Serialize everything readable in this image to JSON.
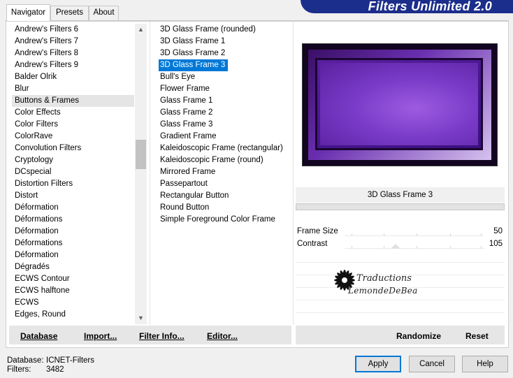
{
  "tabs": [
    {
      "label": "Navigator",
      "active": true
    },
    {
      "label": "Presets",
      "active": false
    },
    {
      "label": "About",
      "active": false
    }
  ],
  "banner_title": "Filters Unlimited 2.0",
  "categories": {
    "items": [
      "Andrew's Filters 6",
      "Andrew's Filters 7",
      "Andrew's Filters 8",
      "Andrew's Filters 9",
      "Balder Olrik",
      "Blur",
      "Buttons & Frames",
      "Color Effects",
      "Color Filters",
      "ColorRave",
      "Convolution Filters",
      "Cryptology",
      "DCspecial",
      "Distortion Filters",
      "Distort",
      "Déformation",
      "Déformations",
      "Déformation",
      "Déformations",
      "Déformation",
      "Dégradés",
      "ECWS Contour",
      "ECWS halftone",
      "ECWS",
      "Edges, Round"
    ],
    "selected_index": 6
  },
  "filters": {
    "items": [
      {
        "label": "3D Glass Frame (rounded)",
        "group": false
      },
      {
        "label": "3D Glass Frame 1",
        "group": false
      },
      {
        "label": "3D Glass Frame 2",
        "group": false
      },
      {
        "label": "3D Glass Frame 3",
        "group": false
      },
      {
        "label": "Bull's Eye",
        "group": false
      },
      {
        "label": "Flower Frame",
        "group": true
      },
      {
        "label": "Glass Frame 1",
        "group": false
      },
      {
        "label": "Glass Frame 2",
        "group": false
      },
      {
        "label": "Glass Frame 3",
        "group": false
      },
      {
        "label": "Gradient Frame",
        "group": true
      },
      {
        "label": "Kaleidoscopic Frame (rectangular)",
        "group": false
      },
      {
        "label": "Kaleidoscopic Frame (round)",
        "group": false
      },
      {
        "label": "Mirrored Frame",
        "group": false
      },
      {
        "label": "Passepartout",
        "group": true
      },
      {
        "label": "Rectangular Button",
        "group": false
      },
      {
        "label": "Round Button",
        "group": false
      },
      {
        "label": "Simple Foreground Color Frame",
        "group": false
      }
    ],
    "selected_index": 3
  },
  "left_buttons": {
    "database": "Database",
    "import": "Import...",
    "filter_info": "Filter Info...",
    "editor": "Editor..."
  },
  "filter_title": "3D Glass Frame 3",
  "params": [
    {
      "label": "Frame Size",
      "value": "50"
    },
    {
      "label": "Contrast",
      "value": "105"
    }
  ],
  "watermark": {
    "line1": "Traductions",
    "line2": "LemondeDeBea"
  },
  "right_buttons": {
    "randomize": "Randomize",
    "reset": "Reset"
  },
  "footer": {
    "database_label": "Database:",
    "database_value": "ICNET-Filters",
    "filters_label": "Filters:",
    "filters_value": "3482"
  },
  "dialog_buttons": {
    "apply": "Apply",
    "cancel": "Cancel",
    "help": "Help"
  },
  "colors": {
    "accent": "#0078d7",
    "banner": "#1c2e8c"
  }
}
